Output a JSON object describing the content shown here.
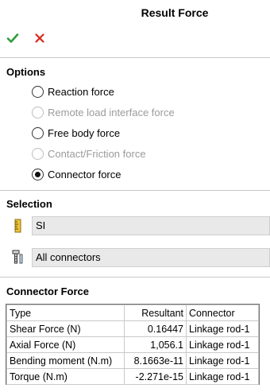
{
  "header": {
    "title": "Result Force"
  },
  "toolbar": {
    "ok_icon": "checkmark-icon",
    "cancel_icon": "close-icon"
  },
  "options": {
    "heading": "Options",
    "items": [
      {
        "label": "Reaction force",
        "checked": false,
        "enabled": true
      },
      {
        "label": "Remote load interface force",
        "checked": false,
        "enabled": false
      },
      {
        "label": "Free body force",
        "checked": false,
        "enabled": true
      },
      {
        "label": "Contact/Friction force",
        "checked": false,
        "enabled": false
      },
      {
        "label": "Connector force",
        "checked": true,
        "enabled": true
      }
    ]
  },
  "selection": {
    "heading": "Selection",
    "units_value": "SI",
    "units_icon": "ruler-icon",
    "connectors_value": "All connectors",
    "connectors_icon": "bolt-connector-icon"
  },
  "connector_force": {
    "heading": "Connector Force",
    "columns": [
      "Type",
      "Resultant",
      "Connector"
    ],
    "rows": [
      [
        "Shear Force (N)",
        "0.16447",
        "Linkage rod-1"
      ],
      [
        "Axial Force (N)",
        "1,056.1",
        "Linkage rod-1"
      ],
      [
        "Bending moment (N.m)",
        "8.1663e-11",
        "Linkage rod-1"
      ],
      [
        "Torque (N.m)",
        "-2.271e-15",
        "Linkage rod-1"
      ]
    ]
  },
  "colors": {
    "ok": "#2e9e3a",
    "cancel": "#d9261c",
    "field_bg": "#e9e9e9"
  }
}
